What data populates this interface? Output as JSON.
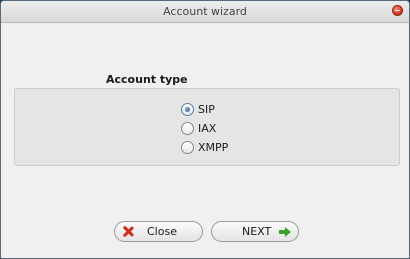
{
  "window": {
    "title": "Account wizard",
    "close_icon": "close-circle-icon"
  },
  "account_type": {
    "label": "Account type",
    "options": [
      {
        "label": "SIP",
        "selected": true
      },
      {
        "label": "IAX",
        "selected": false
      },
      {
        "label": "XMPP",
        "selected": false
      }
    ]
  },
  "buttons": {
    "close_label": "Close",
    "next_label": "NEXT"
  },
  "colors": {
    "close_icon": "#d42a1a",
    "next_arrow": "#3aa12a",
    "window_bg": "#f0f0f0"
  }
}
